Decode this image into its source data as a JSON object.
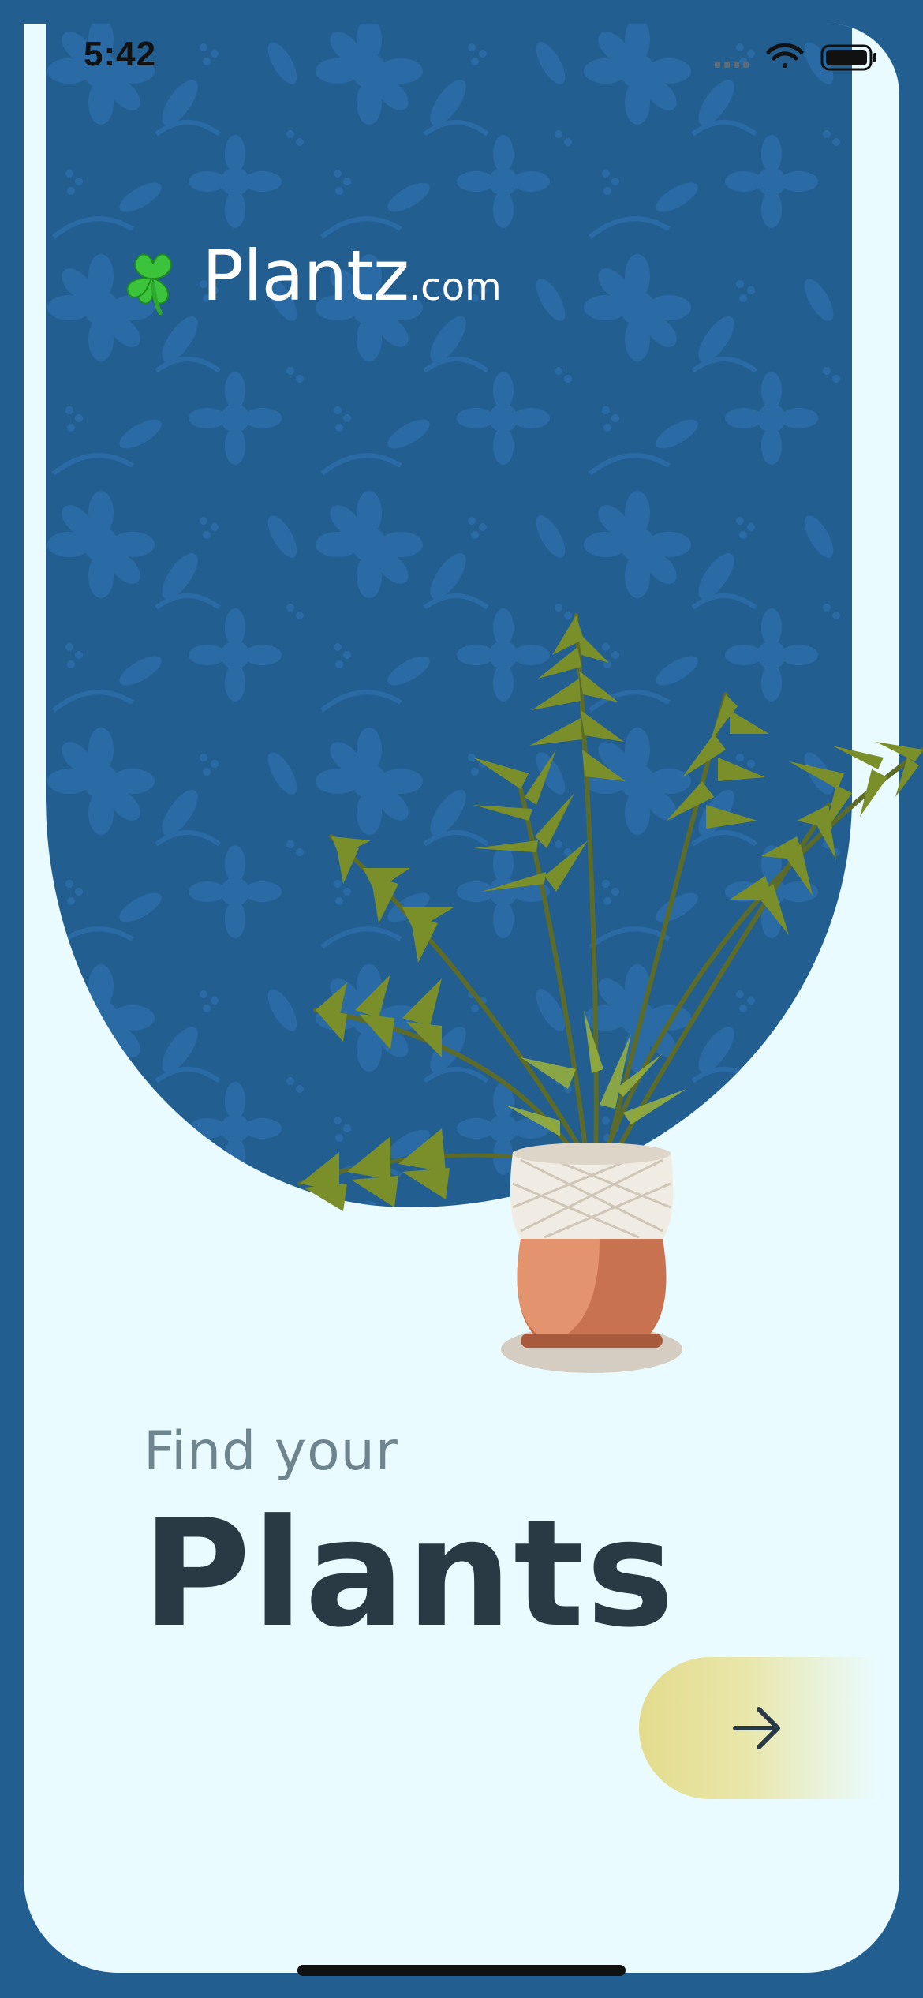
{
  "status_bar": {
    "time": "5:42",
    "icons": [
      "signal-icon",
      "wifi-icon",
      "battery-icon"
    ]
  },
  "brand": {
    "logo_icon": "clover-icon",
    "name": "Plantz",
    "suffix": ".com"
  },
  "hero": {
    "illustration": "potted-palm-plant",
    "pattern": "floral-pattern"
  },
  "content": {
    "subtitle": "Find your",
    "title": "Plants"
  },
  "actions": {
    "next_icon": "arrow-right-icon"
  },
  "colors": {
    "background": "#235E91",
    "card": "#E9FBFE",
    "title": "#2A3A45",
    "subtitle": "#6E858F",
    "button_gradient_start": "#E3DC8E"
  }
}
